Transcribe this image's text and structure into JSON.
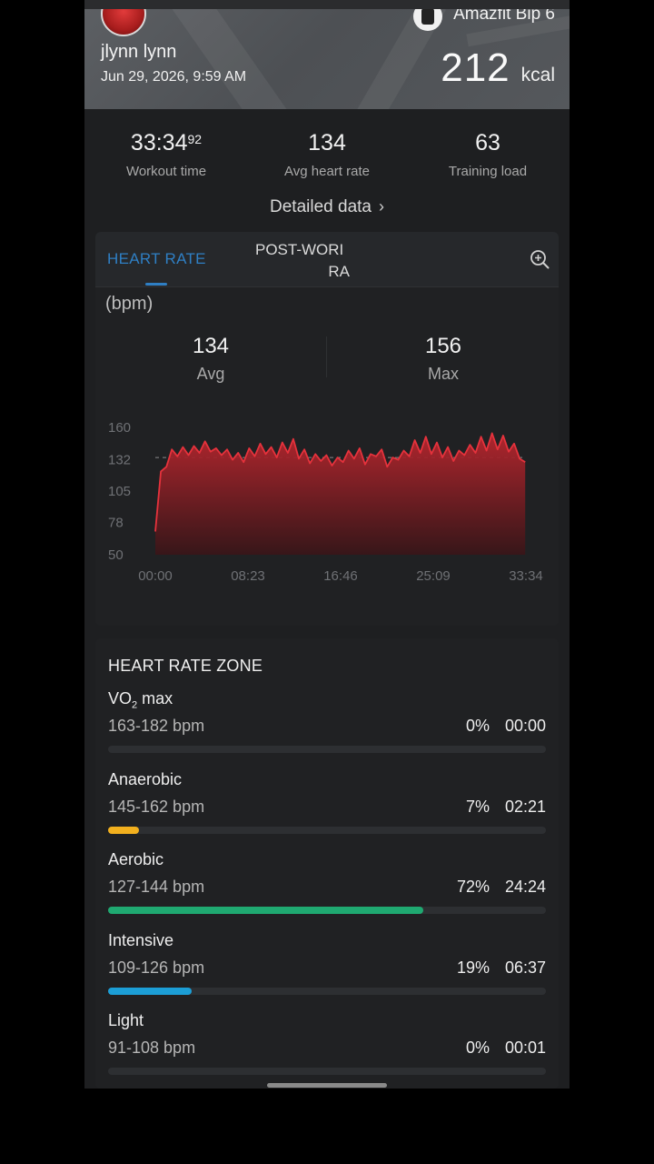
{
  "header": {
    "device_name": "Amazfit Bip 6",
    "user_name": "jlynn lynn",
    "date": "Jun 29, 2026, 9:59 AM",
    "kcal_value": "212",
    "kcal_unit": "kcal"
  },
  "summary": {
    "workout_time_main": "33:34",
    "workout_time_frac": "92",
    "workout_time_label": "Workout time",
    "avg_hr_value": "134",
    "avg_hr_label": "Avg heart rate",
    "training_load_value": "63",
    "training_load_label": "Training load",
    "detailed_link": "Detailed data"
  },
  "hr_card": {
    "tab_active": "HEART RATE",
    "tab_other_line1": "POST-WORI",
    "tab_other_line2": "RA",
    "unit_label": "(bpm)",
    "avg_value": "134",
    "avg_label": "Avg",
    "max_value": "156",
    "max_label": "Max"
  },
  "chart_data": {
    "type": "area",
    "ylim": [
      50,
      160
    ],
    "yticks": [
      "160",
      "132",
      "105",
      "78",
      "50"
    ],
    "xticks": [
      "00:00",
      "08:23",
      "16:46",
      "25:09",
      "33:34"
    ],
    "avg_line": 134,
    "series": [
      {
        "x_minutes": [
          0,
          0.5,
          1,
          1.5,
          2,
          2.5,
          3,
          3.5,
          4,
          4.5,
          5,
          5.5,
          6,
          6.5,
          7,
          7.5,
          8,
          8.5,
          9,
          9.5,
          10,
          10.5,
          11,
          11.5,
          12,
          12.5,
          13,
          13.5,
          14,
          14.5,
          15,
          15.5,
          16,
          16.5,
          17,
          17.5,
          18,
          18.5,
          19,
          19.5,
          20,
          20.5,
          21,
          21.5,
          22,
          22.5,
          23,
          23.5,
          24,
          24.5,
          25,
          25.5,
          26,
          26.5,
          27,
          27.5,
          28,
          28.5,
          29,
          29.5,
          30,
          30.5,
          31,
          31.5,
          32,
          32.5,
          33,
          33.5
        ],
        "values": [
          70,
          122,
          126,
          141,
          135,
          143,
          136,
          144,
          138,
          148,
          139,
          142,
          136,
          141,
          132,
          138,
          130,
          142,
          135,
          146,
          137,
          143,
          134,
          147,
          138,
          150,
          133,
          141,
          129,
          137,
          131,
          136,
          127,
          134,
          130,
          140,
          133,
          142,
          128,
          137,
          135,
          141,
          126,
          134,
          132,
          140,
          135,
          149,
          138,
          152,
          137,
          147,
          134,
          143,
          131,
          140,
          136,
          145,
          138,
          152,
          140,
          155,
          141,
          153,
          139,
          146,
          133,
          130
        ]
      }
    ]
  },
  "zones": {
    "title": "HEART RATE ZONE",
    "items": [
      {
        "name_pre": "VO",
        "name_sub": "2",
        "name_post": " max",
        "range": "163-182 bpm",
        "pct": "0%",
        "pct_value": 0,
        "time": "00:00",
        "color": "#2c2e31"
      },
      {
        "name_pre": "Anaerobic",
        "name_sub": "",
        "name_post": "",
        "range": "145-162 bpm",
        "pct": "7%",
        "pct_value": 7,
        "time": "02:21",
        "color": "#f2b01e"
      },
      {
        "name_pre": "Aerobic",
        "name_sub": "",
        "name_post": "",
        "range": "127-144 bpm",
        "pct": "72%",
        "pct_value": 72,
        "time": "24:24",
        "color": "#1fa971"
      },
      {
        "name_pre": "Intensive",
        "name_sub": "",
        "name_post": "",
        "range": "109-126 bpm",
        "pct": "19%",
        "pct_value": 19,
        "time": "06:37",
        "color": "#1c9ed6"
      },
      {
        "name_pre": "Light",
        "name_sub": "",
        "name_post": "",
        "range": "91-108 bpm",
        "pct": "0%",
        "pct_value": 0,
        "time": "00:01",
        "color": "#8a8a8a"
      }
    ]
  },
  "colors": {
    "accent": "#2f7fc4",
    "hr_line": "#e5323c"
  }
}
